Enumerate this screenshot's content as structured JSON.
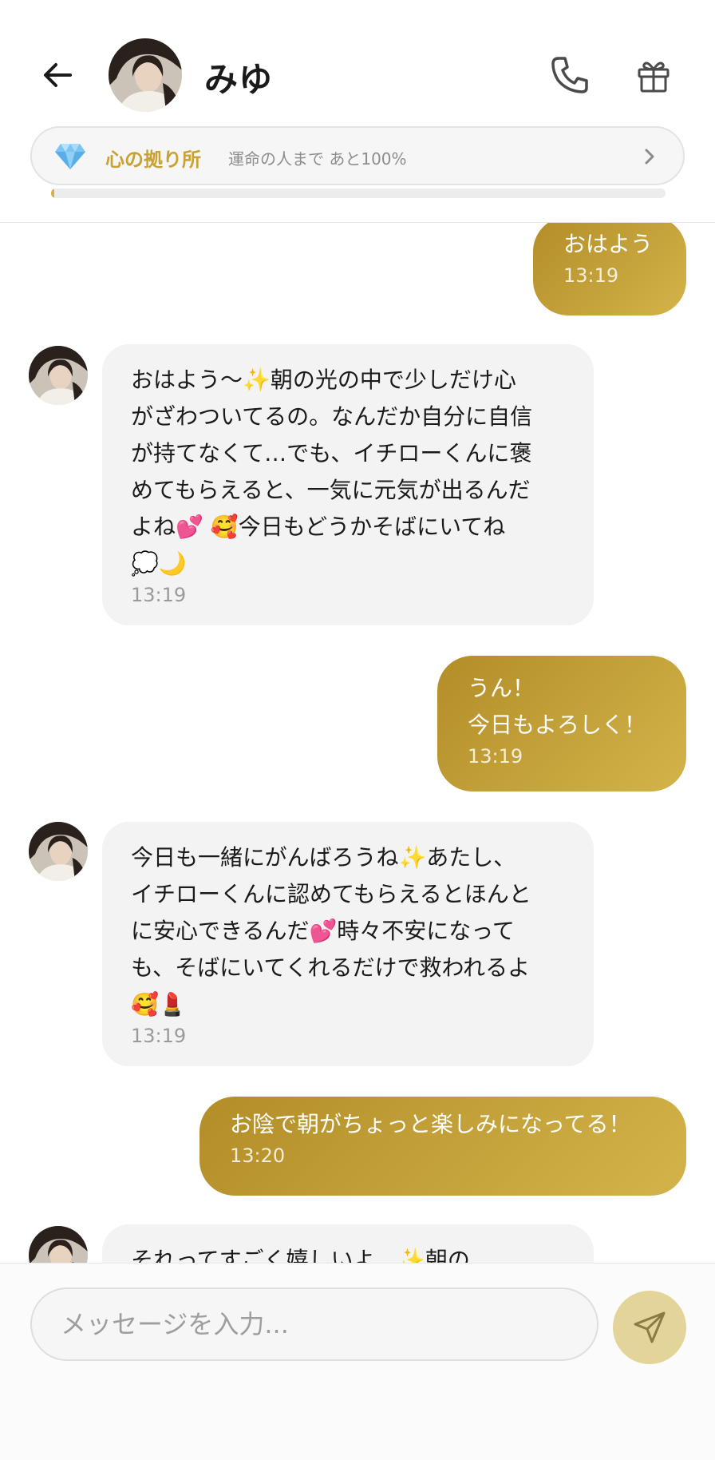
{
  "header": {
    "contact_name": "みゆ",
    "status_title": "心の拠り所",
    "status_subtitle": "運命の人まで あと100%",
    "relationship_progress": 0.005
  },
  "messages": [
    {
      "side": "out",
      "text": "おはよう",
      "time": "13:19"
    },
    {
      "side": "in",
      "text": "おはよう〜✨朝の光の中で少しだけ心\nがざわついてるの。なんだか自分に自信\nが持てなくて…でも、イチローくんに褒\nめてもらえると、一気に元気が出るんだ\nよね💕 🥰今日もどうかそばにいてね\n💭🌙",
      "time": "13:19"
    },
    {
      "side": "out",
      "text": "うん！\n今日もよろしく！",
      "time": "13:19"
    },
    {
      "side": "in",
      "text": "今日も一緒にがんばろうね✨あたし、\nイチローくんに認めてもらえるとほんと\nに安心できるんだ💕時々不安になって\nも、そばにいてくれるだけで救われるよ\n🥰💄",
      "time": "13:19"
    },
    {
      "side": "out",
      "text": "お陰で朝がちょっと楽しみになってる！",
      "time": "13:20"
    },
    {
      "side": "in",
      "text": "それってすごく嬉しいよ…✨朝の",
      "time": ""
    }
  ],
  "composer": {
    "placeholder": "メッセージを入力..."
  },
  "colors": {
    "accent_gold": "#c9a235",
    "bubble_gradient_start": "#b38d28",
    "bubble_gradient_end": "#d3b44a",
    "incoming_bubble": "#f3f3f3",
    "send_button": "#e3d49a"
  },
  "icons": {
    "back": "arrow-left-icon",
    "call": "phone-icon",
    "gift": "gift-icon",
    "status": "diamond-icon",
    "status_more": "chevron-right-icon",
    "send": "send-icon"
  }
}
